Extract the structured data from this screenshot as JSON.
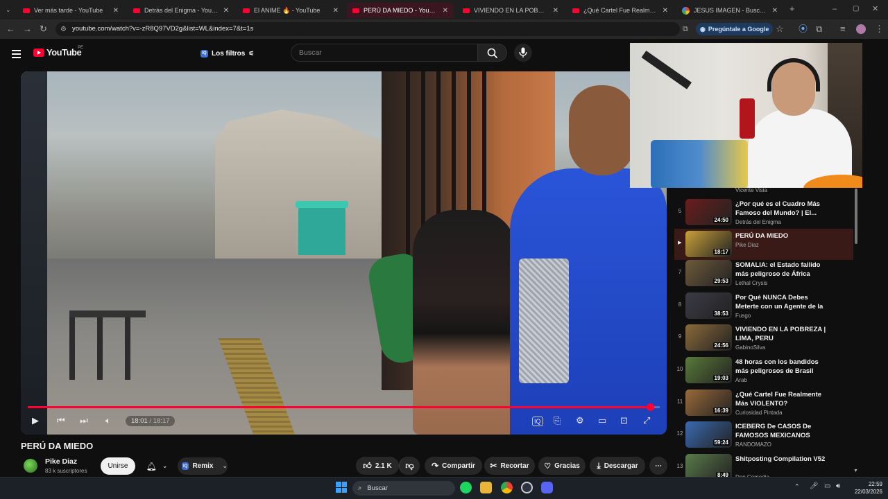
{
  "browser": {
    "tabs": [
      {
        "label": "Ver más tarde - YouTube",
        "active": false,
        "favicon": "youtube-icon"
      },
      {
        "label": "Detrás del Enigma - YouTube",
        "active": false,
        "favicon": "youtube-icon"
      },
      {
        "label": "El ANIME 🔥 - YouTube",
        "active": false,
        "favicon": "youtube-icon"
      },
      {
        "label": "PERÚ DA MIEDO - YouTube",
        "active": true,
        "favicon": "youtube-icon"
      },
      {
        "label": "VIVIENDO EN LA POBREZA | LI",
        "active": false,
        "favicon": "youtube-icon"
      },
      {
        "label": "¿Qué Cartel Fue Realmente Má",
        "active": false,
        "favicon": "youtube-icon"
      },
      {
        "label": "JESUS IMAGEN - Buscar con Go",
        "active": false,
        "favicon": "google-icon"
      }
    ],
    "url": "youtube.com/watch?v=-zR8Q97VD2g&list=WL&index=7&t=1s",
    "ask_google_label": "Pregúntale a Google"
  },
  "youtube": {
    "logo_text": "YouTube",
    "region": "PE",
    "filters_label": "Los filtros",
    "search_placeholder": "Buscar"
  },
  "player": {
    "current_time": "18:01",
    "duration": "18:17",
    "progress": 0.985
  },
  "video": {
    "title": "PERÚ DA MIEDO",
    "channel": "Pike Diaz",
    "subscribers": "83 k suscriptores",
    "join_label": "Unirse",
    "remix_label": "Remix",
    "likes": "2.1 K",
    "share_label": "Compartir",
    "clip_label": "Recortar",
    "thanks_label": "Gracias",
    "download_label": "Descargar"
  },
  "playlist": {
    "top_channel": "Vicente Visia",
    "items": [
      {
        "index": "5",
        "title": "¿Por qué es el Cuadro Más Famoso del Mundo? | El...",
        "channel": "Detrás del Enigma",
        "duration": "24:50",
        "active": false,
        "thumb": "#6a1d1d"
      },
      {
        "index": "▶",
        "title": "PERÚ DA MIEDO",
        "channel": "Pike Diaz",
        "duration": "18:17",
        "active": true,
        "thumb": "#c9a13a"
      },
      {
        "index": "7",
        "title": "SOMALIA: el Estado fallido más peligroso de África",
        "channel": "Lethal Crysis",
        "duration": "29:53",
        "active": false,
        "thumb": "#6e5a3c"
      },
      {
        "index": "8",
        "title": "Por Qué NUNCA Debes Meterte con un Agente de la DEA -...",
        "channel": "Fusgo",
        "duration": "38:53",
        "active": false,
        "thumb": "#3b3b45"
      },
      {
        "index": "9",
        "title": "VIVIENDO EN LA POBREZA | LIMA, PERU",
        "channel": "GabinoSilva",
        "duration": "24:56",
        "active": false,
        "thumb": "#8a6a3a"
      },
      {
        "index": "10",
        "title": "48 horas con los bandidos más peligrosos de Brasil",
        "channel": "Arab",
        "duration": "19:03",
        "active": false,
        "thumb": "#5a7a3a"
      },
      {
        "index": "11",
        "title": "¿Qué Cartel Fue Realmente Más VIOLENTO?",
        "channel": "Curiosidad Pintada",
        "duration": "16:39",
        "active": false,
        "thumb": "#9a6a3a"
      },
      {
        "index": "12",
        "title": "ICEBERG De CASOS De FAMOSOS MEXICANOS",
        "channel": "RANDOMAZO",
        "duration": "59:24",
        "active": false,
        "thumb": "#3a6ab0"
      },
      {
        "index": "13",
        "title": "Shitposting Compilation V52",
        "channel": "Don Comedia",
        "duration": "8:49",
        "active": false,
        "thumb": "#5a7a4a"
      }
    ]
  },
  "taskbar": {
    "search_placeholder": "Buscar",
    "time": "22:59",
    "date": "22/03/2026"
  }
}
